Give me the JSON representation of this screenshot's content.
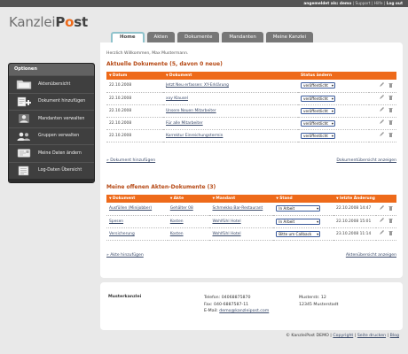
{
  "toplinks": {
    "user": "angemeldet als: demo",
    "support": "Support",
    "hilfe": "Hilfe",
    "logout": "Log out",
    "sep": " | "
  },
  "logo": {
    "light": "Kanzlei",
    "bold_pre": "P",
    "bold_o": "o",
    "bold_post": "st"
  },
  "tabs": [
    "Home",
    "Akten",
    "Dokumente",
    "Mandanten",
    "Meine Kanzlei"
  ],
  "sidebar": {
    "title": "Optionen",
    "items": [
      {
        "label": "Aktenübersicht",
        "icon": "folder-icon"
      },
      {
        "label": "Dokument hinzufügen",
        "icon": "add-document-icon"
      },
      {
        "label": "Mandanten verwalten",
        "icon": "user-icon"
      },
      {
        "label": "Gruppen verwalten",
        "icon": "group-icon"
      },
      {
        "label": "Meine Daten ändern",
        "icon": "edit-data-icon"
      },
      {
        "label": "Log-Daten Übersicht",
        "icon": "log-icon"
      }
    ]
  },
  "welcome": "Herzlich Willkommen, Max Mustermann.",
  "docs": {
    "title": "Aktuelle Dokumente (5, davon 0 neue)",
    "headers": [
      "Datum",
      "Dokument",
      "Status ändern"
    ],
    "rows": [
      {
        "date": "22.10.2008",
        "doc": "Jetzt Neu erfassen: XY-Erklärung",
        "status": "veröffentlicht"
      },
      {
        "date": "22.10.2008",
        "doc": "xxy Klausel",
        "status": "veröffentlicht"
      },
      {
        "date": "22.10.2008",
        "doc": "Unsere Neuen Mitarbeiter",
        "status": "veröffentlicht"
      },
      {
        "date": "22.10.2008",
        "doc": "Für alle Mitarbeiter",
        "status": "veröffentlicht"
      },
      {
        "date": "22.10.2008",
        "doc": "Korrektur Einreichungstermin",
        "status": "veröffentlicht"
      }
    ],
    "add_link": "» Dokument hinzufügen",
    "overview_link": "Dokumentübersicht anzeigen"
  },
  "files": {
    "title": "Meine offenen Akten-Dokumente (3)",
    "headers": [
      "Dokument",
      "Akte",
      "Mandant",
      "Stand",
      "letzte Änderung"
    ],
    "rows": [
      {
        "doc": "Ausfüllen (Minijobber)",
        "akte": "Gehälter 08",
        "mandant": "Schmekko Bar-Restaurant",
        "stand": "In Arbeit",
        "changed": "22.10.2008 14:47"
      },
      {
        "doc": "Spesen",
        "akte": "Kosten",
        "mandant": "Wohlfühl Hotel",
        "stand": "In Arbeit",
        "changed": "22.10.2008 15:01"
      },
      {
        "doc": "Versicherung",
        "akte": "Kosten",
        "mandant": "Wohlfühl Hotel",
        "stand": "Bitte um Callback",
        "changed": "23.10.2008 11:14"
      }
    ],
    "add_link": "» Akte hinzufügen",
    "overview_link": "Aktenübersicht anzeigen"
  },
  "contact": {
    "name": "Musterkanzlei",
    "phone": "Telefon: 04068875870",
    "fax": "Fax: 040-6887587-11",
    "email_label": "E-Mail: ",
    "email": "demo@kanzleipost.com",
    "street": "Musterstr. 12",
    "city": "12345 Musterstadt"
  },
  "footer": {
    "company": "© KanzleiPost DEMO | ",
    "copyright": "Copyright",
    "print": "Seite drucken",
    "blog": "Blog"
  },
  "colors": {
    "accent": "#ee6a1a",
    "title": "#b54712",
    "sidebar": "#3f3f3f",
    "tab_active_border": "#8fc3cc"
  }
}
